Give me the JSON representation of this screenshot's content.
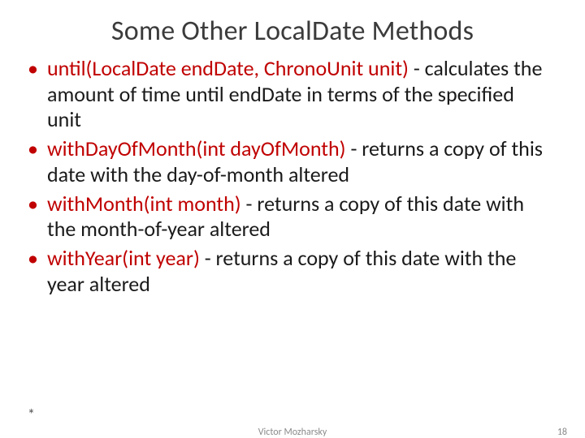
{
  "slide": {
    "title": "Some Other LocalDate Methods",
    "bullets": [
      {
        "method": "until(LocalDate endDate, ChronoUnit unit)",
        "desc": " - calculates the amount of time until endDate in terms of the specified unit"
      },
      {
        "method": "withDayOfMonth(int dayOfMonth)",
        "desc": " - returns a copy of this date with the day-of-month altered"
      },
      {
        "method": "withMonth(int month)",
        "desc": " - returns a copy of this date with the month-of-year altered"
      },
      {
        "method": "withYear(int year)",
        "desc": " - returns a copy of this date with the year altered"
      }
    ],
    "footer": {
      "asterisk": "*",
      "author": "Victor Mozharsky",
      "page": "18"
    }
  }
}
